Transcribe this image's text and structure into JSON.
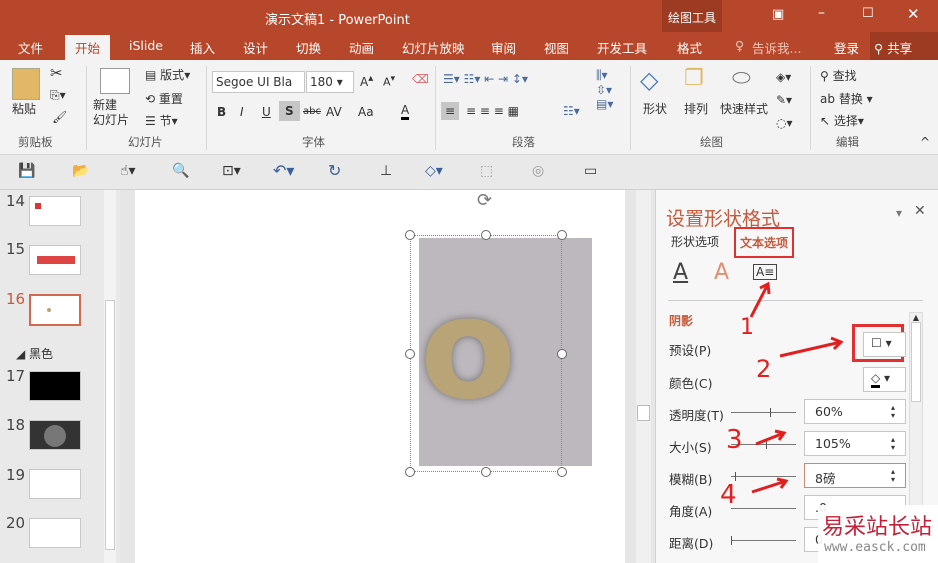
{
  "title": "演示文稿1 - PowerPoint",
  "context_tab_group": "绘图工具",
  "tabs": [
    "文件",
    "开始",
    "iSlide",
    "插入",
    "设计",
    "切换",
    "动画",
    "幻灯片放映",
    "审阅",
    "视图",
    "开发工具",
    "格式"
  ],
  "tell_me": "告诉我...",
  "login": "登录",
  "share": "共享",
  "ribbon": {
    "clipboard": {
      "paste": "粘贴",
      "label": "剪贴板"
    },
    "slides": {
      "new_slide": "新建\n幻灯片",
      "layout": "版式",
      "reset": "重置",
      "section": "节",
      "label": "幻灯片"
    },
    "font": {
      "font_name": "Segoe UI Bla",
      "font_size": "180",
      "bold": "B",
      "italic": "I",
      "underline": "U",
      "shadow": "S",
      "strike": "abc",
      "spacing": "AV",
      "case": "Aa",
      "label": "字体"
    },
    "paragraph": {
      "label": "段落"
    },
    "drawing": {
      "shapes": "形状",
      "arrange": "排列",
      "quick_styles": "快速样式",
      "label": "绘图"
    },
    "editing": {
      "find": "查找",
      "replace": "替换",
      "select": "选择",
      "label": "编辑"
    }
  },
  "thumbnails": {
    "slides": [
      "14",
      "15",
      "16",
      "17",
      "18",
      "19",
      "20"
    ],
    "active": "16",
    "section": "黑色"
  },
  "slide": {
    "text": "o",
    "shape_color": "#bcb8bd",
    "text_color": "#b9a478"
  },
  "pane": {
    "title": "设置形状格式",
    "tabs": [
      "形状选项",
      "文本选项"
    ],
    "section": "阴影",
    "preset_label": "预设(P)",
    "color_label": "颜色(C)",
    "transparency_label": "透明度(T)",
    "transparency": "60%",
    "size_label": "大小(S)",
    "size": "105%",
    "blur_label": "模糊(B)",
    "blur": "8磅",
    "angle_label": "角度(A)",
    "angle": ".0",
    "distance_label": "距离(D)",
    "distance": "0"
  },
  "annotations": [
    "1",
    "2",
    "3",
    "4"
  ],
  "watermark": {
    "name": "易采站长站",
    "url": "www.easck.com"
  },
  "colors": {
    "accent": "#b7472a",
    "annotation": "#e02020"
  }
}
